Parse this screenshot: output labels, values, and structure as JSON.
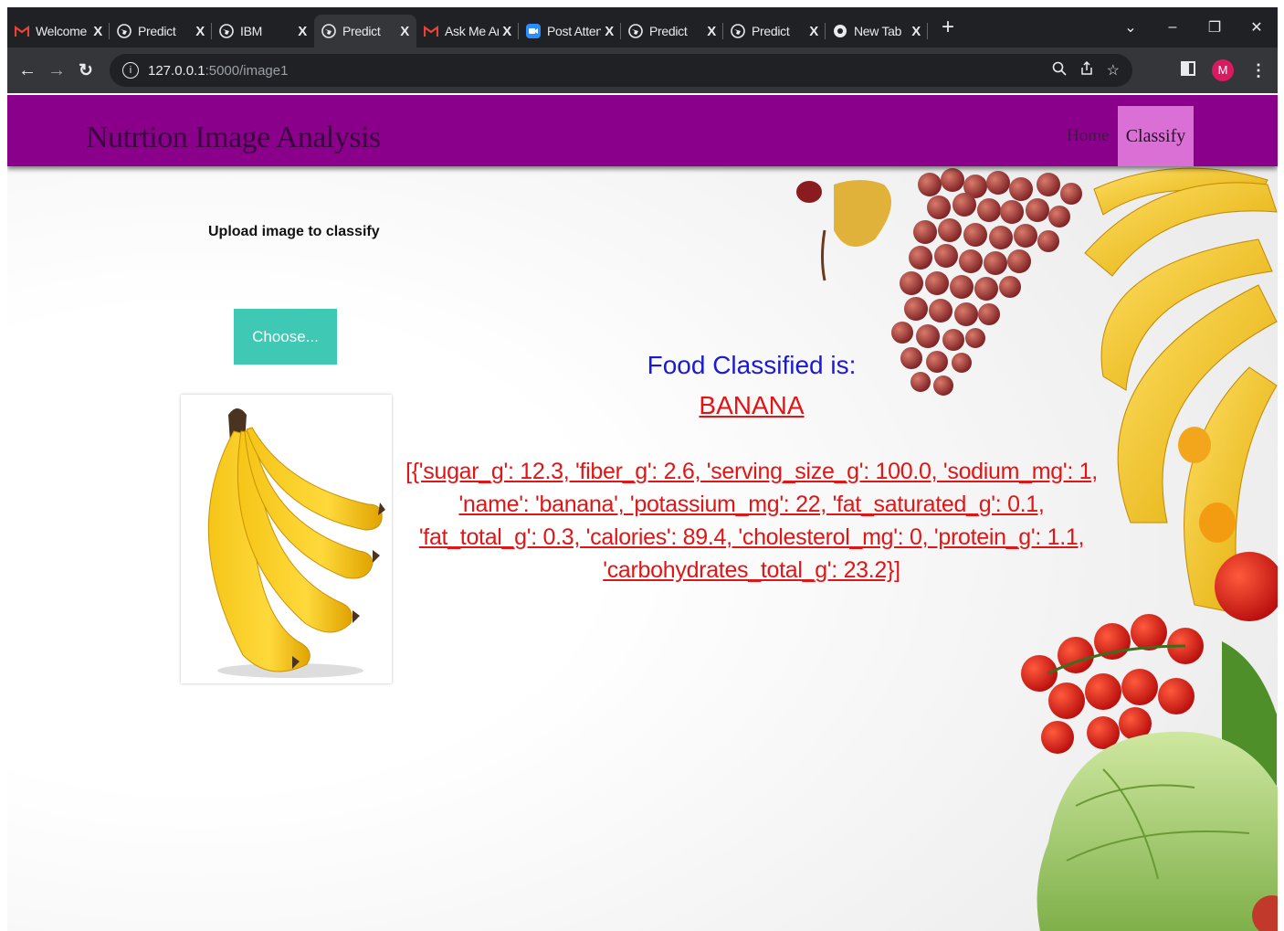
{
  "browser": {
    "tabs": [
      {
        "label": "Welcome t",
        "icon": "gmail-icon",
        "active": false
      },
      {
        "label": "Predict",
        "icon": "globe-icon",
        "active": false
      },
      {
        "label": "IBM",
        "icon": "globe-icon",
        "active": false
      },
      {
        "label": "Predict",
        "icon": "globe-icon",
        "active": true
      },
      {
        "label": "Ask Me Ar",
        "icon": "gmail-icon",
        "active": false
      },
      {
        "label": "Post Atten",
        "icon": "zoom-icon",
        "active": false
      },
      {
        "label": "Predict",
        "icon": "globe-icon",
        "active": false
      },
      {
        "label": "Predict",
        "icon": "globe-icon",
        "active": false
      },
      {
        "label": "New Tab",
        "icon": "chrome-icon",
        "active": false
      }
    ],
    "close_glyph": "X",
    "new_tab_glyph": "+",
    "url_host": "127.0.0.1",
    "url_path": ":5000/image1",
    "profile_initial": "M"
  },
  "header": {
    "brand": "Nutrtion Image Analysis",
    "nav_home": "Home",
    "nav_classify": "Classify"
  },
  "upload": {
    "title": "Upload image to classify",
    "choose_label": "Choose..."
  },
  "result": {
    "label": "Food Classified is:",
    "food": "BANANA",
    "nutrition": "[{'sugar_g': 12.3, 'fiber_g': 2.6, 'serving_size_g': 100.0, 'sodium_mg': 1, 'name': 'banana', 'potassium_mg': 22, 'fat_saturated_g': 0.1, 'fat_total_g': 0.3, 'calories': 89.4, 'cholesterol_mg': 0, 'protein_g': 1.1, 'carbohydrates_total_g': 23.2}]"
  },
  "colors": {
    "header_bg": "#8b008b",
    "classify_bg": "#da70d6",
    "choose_bg": "#3fc8b4",
    "label_blue": "#1a1ad6",
    "result_red": "#e01616"
  }
}
